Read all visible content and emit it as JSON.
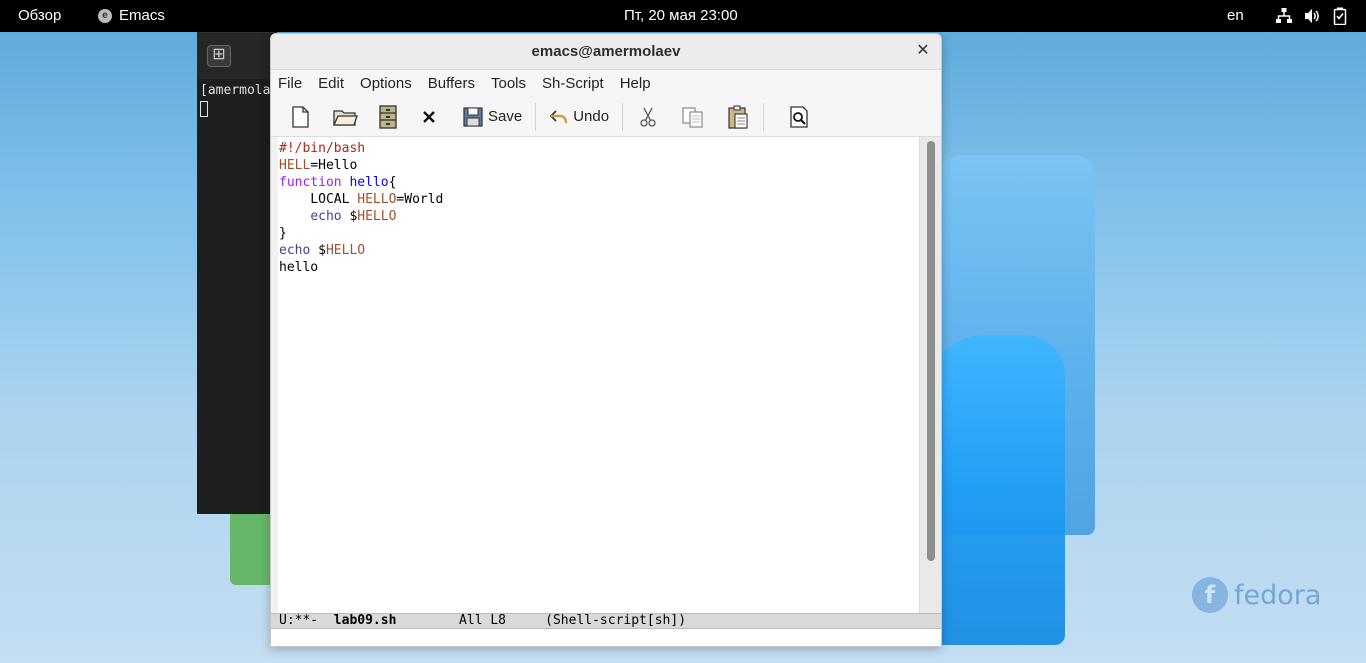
{
  "topbar": {
    "overview": "Обзор",
    "app_name": "Emacs",
    "clock": "Пт, 20 мая  23:00",
    "language": "en"
  },
  "terminal": {
    "partial_text": "[amermola"
  },
  "emacs": {
    "title": "emacs@amermolaev",
    "menu": [
      "File",
      "Edit",
      "Options",
      "Buffers",
      "Tools",
      "Sh-Script",
      "Help"
    ],
    "toolbar": {
      "save_label": "Save",
      "undo_label": "Undo"
    },
    "code_lines": [
      [
        {
          "t": "#!/bin/bash",
          "c": "comment"
        }
      ],
      [
        {
          "t": "HELL",
          "c": "var"
        },
        {
          "t": "=Hello",
          "c": ""
        }
      ],
      [
        {
          "t": "function",
          "c": "kw"
        },
        {
          "t": " ",
          "c": ""
        },
        {
          "t": "hello",
          "c": "fn"
        },
        {
          "t": "{",
          "c": ""
        }
      ],
      [
        {
          "t": "    LOCAL ",
          "c": ""
        },
        {
          "t": "HELLO",
          "c": "var"
        },
        {
          "t": "=World",
          "c": ""
        }
      ],
      [
        {
          "t": "    ",
          "c": ""
        },
        {
          "t": "echo",
          "c": "builtin"
        },
        {
          "t": " $",
          "c": ""
        },
        {
          "t": "HELLO",
          "c": "var"
        }
      ],
      [
        {
          "t": "}",
          "c": ""
        }
      ],
      [
        {
          "t": "echo",
          "c": "builtin"
        },
        {
          "t": " $",
          "c": ""
        },
        {
          "t": "HELLO",
          "c": "var"
        }
      ],
      [
        {
          "t": "hello",
          "c": ""
        }
      ]
    ],
    "modeline": {
      "status": "U:**-  ",
      "buffer": "lab09.sh",
      "position": "        All L8     ",
      "mode": "(Shell-script[sh])"
    }
  },
  "wallpaper": {
    "brand": "fedora"
  },
  "colors": {
    "topbar_bg": "#000000",
    "comment": "#b22222",
    "variable": "#a0522d",
    "keyword": "#a020f0",
    "function": "#0000ff",
    "builtin": "#483d8b"
  }
}
